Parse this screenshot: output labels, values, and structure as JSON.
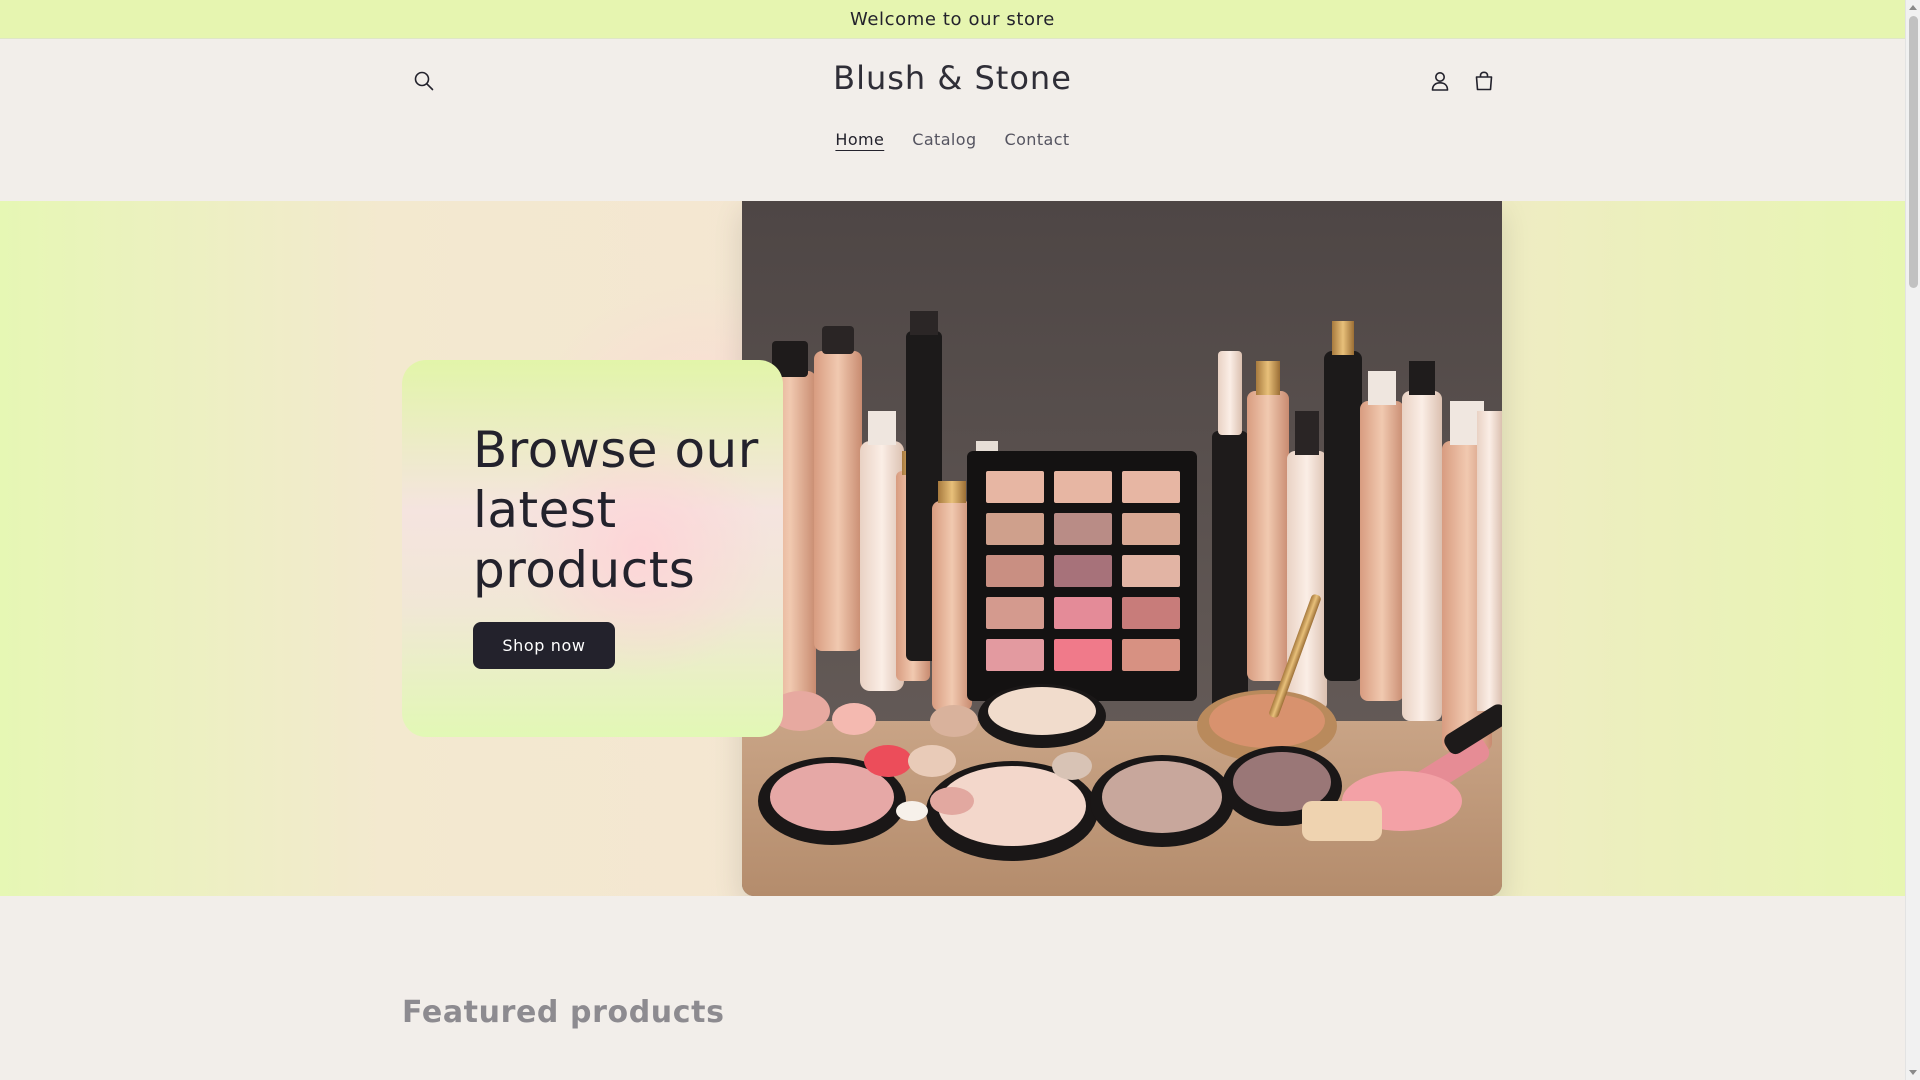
{
  "announcement": {
    "text": "Welcome to our store"
  },
  "header": {
    "logo": "Blush & Stone",
    "icons": {
      "search": "search-icon",
      "account": "account-icon",
      "cart": "cart-icon"
    }
  },
  "nav": {
    "items": [
      {
        "label": "Home",
        "active": true
      },
      {
        "label": "Catalog",
        "active": false
      },
      {
        "label": "Contact",
        "active": false
      }
    ]
  },
  "hero": {
    "heading": "Browse our latest products",
    "button_label": "Shop now",
    "image": "cosmetics-product-arrangement"
  },
  "featured": {
    "title": "Featured products"
  },
  "colors": {
    "announcement_bg": "#e6f5b0",
    "page_bg": "#f2eeea",
    "button_bg": "#23222c",
    "text": "#23222c"
  }
}
